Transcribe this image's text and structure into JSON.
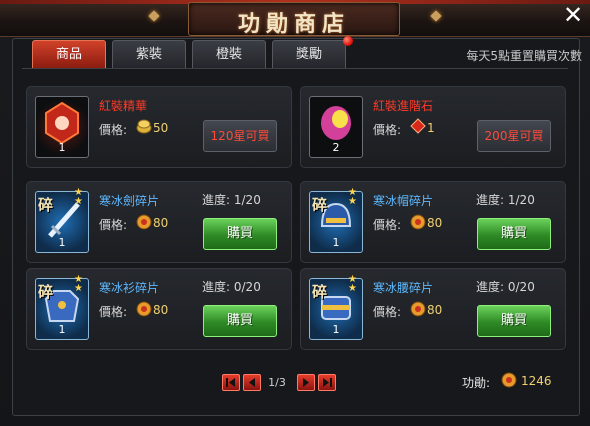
{
  "window": {
    "title": "功勛商店",
    "close_symbol": "✕"
  },
  "tabs": [
    {
      "label": "商品",
      "active": true
    },
    {
      "label": "紫裝",
      "active": false
    },
    {
      "label": "橙裝",
      "active": false
    },
    {
      "label": "獎勵",
      "active": false,
      "has_notification": true
    }
  ],
  "reset_notice": "每天5點重置購買次數",
  "price_label": "價格:",
  "progress_label": "進度:",
  "buy_label": "購買",
  "items": [
    {
      "name": "紅裝精華",
      "name_color": "red",
      "count": "1",
      "price": "50",
      "currency_icon": "gold-coin-icon",
      "button": "120星可買",
      "button_enabled": false
    },
    {
      "name": "紅裝進階石",
      "name_color": "red",
      "count": "2",
      "price": "1",
      "currency_icon": "red-gem-icon",
      "button": "200星可買",
      "button_enabled": false
    },
    {
      "name": "寒冰劍碎片",
      "name_color": "blue",
      "count": "1",
      "fragment_mark": "碎",
      "price": "80",
      "currency_icon": "merit-medal-icon",
      "progress": "1/20",
      "button_enabled": true
    },
    {
      "name": "寒冰帽碎片",
      "name_color": "blue",
      "count": "1",
      "fragment_mark": "碎",
      "price": "80",
      "currency_icon": "merit-medal-icon",
      "progress": "1/20",
      "button_enabled": true
    },
    {
      "name": "寒冰衫碎片",
      "name_color": "blue",
      "count": "1",
      "fragment_mark": "碎",
      "price": "80",
      "currency_icon": "merit-medal-icon",
      "progress": "0/20",
      "button_enabled": true
    },
    {
      "name": "寒冰腰碎片",
      "name_color": "blue",
      "count": "1",
      "fragment_mark": "碎",
      "price": "80",
      "currency_icon": "merit-medal-icon",
      "progress": "0/20",
      "button_enabled": true
    }
  ],
  "pager": {
    "page": "1/3"
  },
  "merit": {
    "label": "功勛:",
    "value": "1246"
  },
  "colors": {
    "accent_red": "#c8321f",
    "buy_green": "#35a02b",
    "price_gold": "#f0d070",
    "name_red": "#ff3b2a",
    "name_blue": "#5eb9ff"
  }
}
